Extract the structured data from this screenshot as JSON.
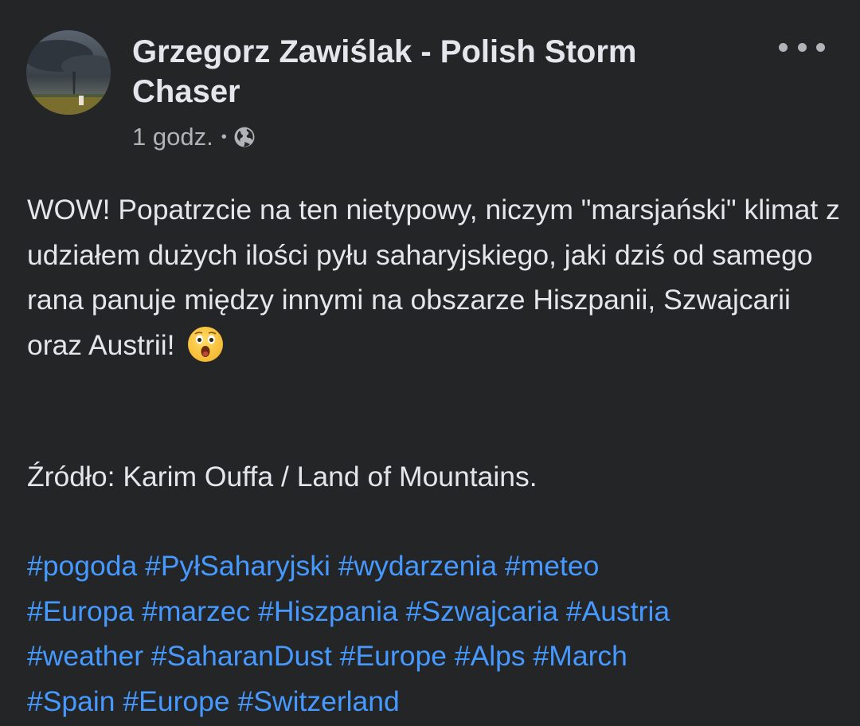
{
  "post": {
    "author": "Grzegorz Zawiślak - Polish Storm Chaser",
    "time": "1 godz.",
    "separator": "•",
    "privacy_icon": "globe-icon",
    "more_icon": "more-options-icon",
    "avatar_description": "storm-cloud-photo",
    "body": "WOW! Popatrzcie na ten nietypowy, niczym \"marsjański\" klimat z udziałem dużych ilości pyłu saharyjskiego, jaki dziś od samego rana panuje między innymi na obszarze Hiszpanii, Szwajcarii oraz Austrii!",
    "emoji": "😮",
    "emoji_icon": "astonished-face-icon",
    "source": "Źródło: Karim Ouffa / Land of Mountains.",
    "hashtags": [
      "#pogoda",
      "#PyłSaharyjski",
      "#wydarzenia",
      "#meteo",
      "#Europa",
      "#marzec",
      "#Hiszpania",
      "#Szwajcaria",
      "#Austria",
      "#weather",
      "#SaharanDust",
      "#Europe",
      "#Alps",
      "#March",
      "#Spain",
      "#Europe",
      "#Switzerland"
    ]
  },
  "colors": {
    "background": "#242526",
    "primary_text": "#e4e6eb",
    "secondary_text": "#b0b3b8",
    "link": "#4599ff"
  }
}
